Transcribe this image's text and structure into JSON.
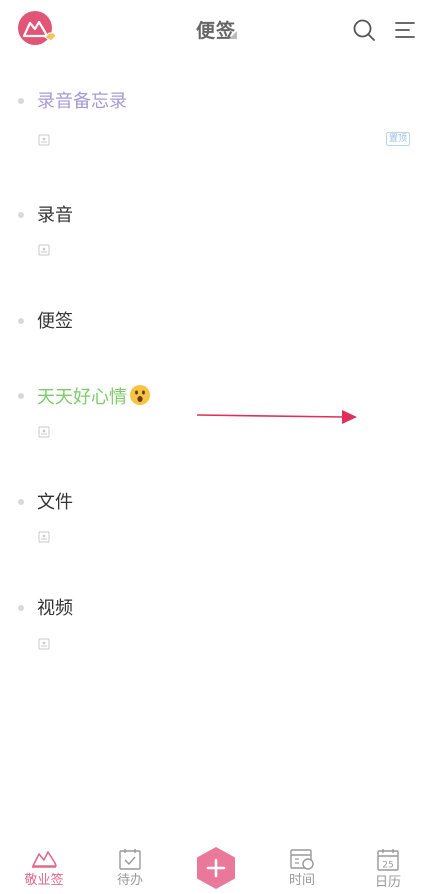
{
  "header": {
    "title": "便签"
  },
  "notes": [
    {
      "title": "录音备忘录",
      "color": "#a79ad6",
      "pinned_label": "置顶"
    },
    {
      "title": "录音",
      "color": "#333333"
    },
    {
      "title": "便签",
      "color": "#333333"
    },
    {
      "title": "天天好心情",
      "color": "#7ccc6a",
      "emoji": "astonished-face-emoji"
    },
    {
      "title": "文件",
      "color": "#333333"
    },
    {
      "title": "视频",
      "color": "#333333"
    }
  ],
  "bottom_nav": {
    "items": [
      {
        "label": "敬业签",
        "icon": "home-shoe-icon",
        "active": true
      },
      {
        "label": "待办",
        "icon": "calendar-check-icon"
      },
      {
        "label": "时间",
        "icon": "calendar-clock-icon"
      },
      {
        "label": "日历",
        "icon": "calendar-date-icon",
        "day": "25"
      }
    ],
    "fab_icon": "plus-icon"
  },
  "colors": {
    "accent": "#e06a8c",
    "annotation_arrow": "#e0305a"
  }
}
